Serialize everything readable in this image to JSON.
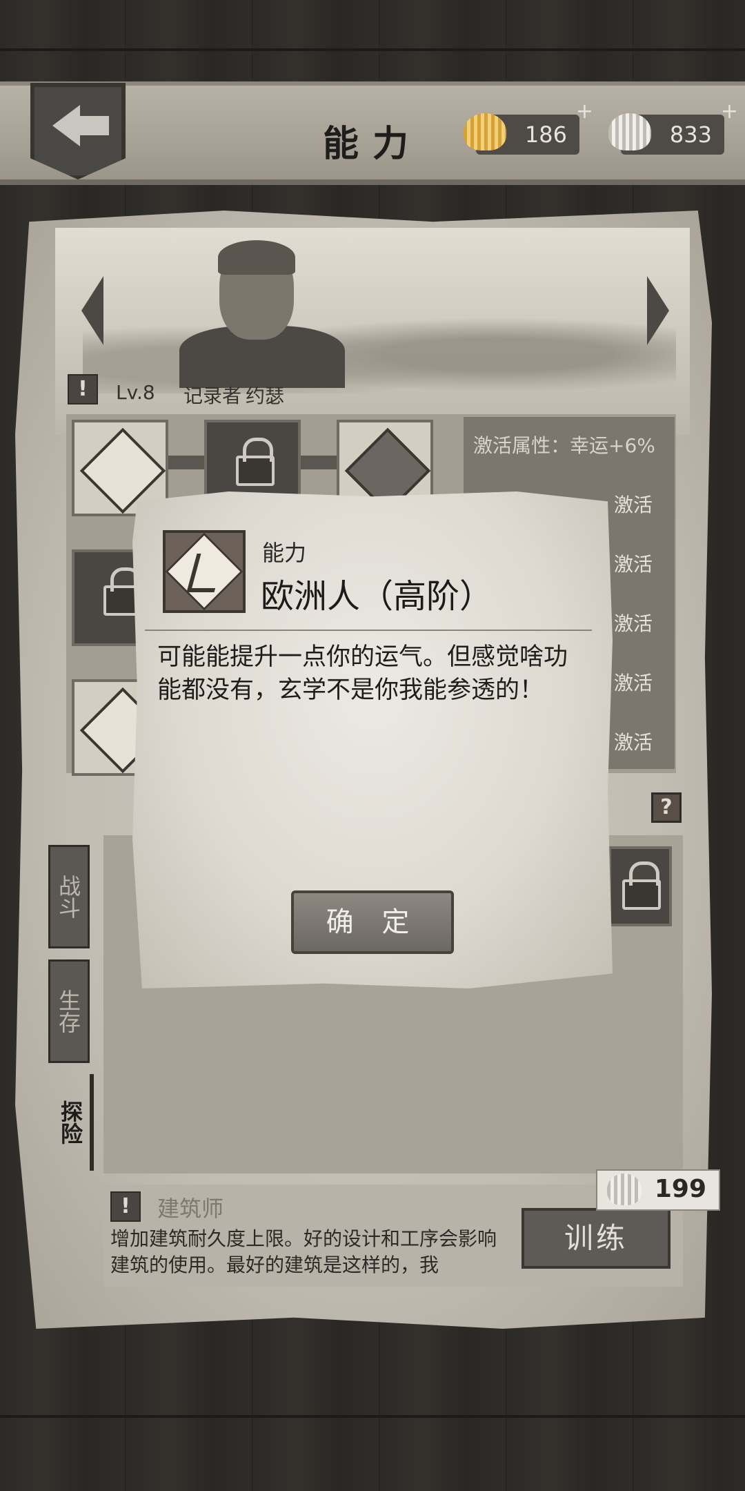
{
  "header": {
    "title": "能力",
    "currency_gold": "186",
    "currency_silver": "833",
    "plus_gold": "+",
    "plus_silver": "+"
  },
  "character": {
    "level": "Lv.8",
    "role": "记录者",
    "name": "约瑟"
  },
  "attributes": {
    "active": "激活属性：幸运+6%",
    "row1": "激活",
    "row2": "激活",
    "row3": "激活",
    "row4": "激活",
    "row5": "激活"
  },
  "tabs": [
    {
      "label": "战斗"
    },
    {
      "label": "生存"
    },
    {
      "label": "探险"
    }
  ],
  "skill_desc": {
    "title": "建筑师",
    "text": "增加建筑耐久度上限。好的设计和工序会影响建筑的使用。最好的建筑是这样的，我"
  },
  "train": {
    "label": "训练",
    "cost": "199"
  },
  "modal": {
    "kind": "能力",
    "name": "欧洲人（高阶）",
    "description": "可能能提升一点你的运气。但感觉啥功能都没有，玄学不是你我能参透的！",
    "confirm": "确 定"
  },
  "icons": [
    "back-arrow-icon",
    "gold-shell-icon",
    "silver-shell-icon",
    "warning-icon",
    "lock-icon",
    "stomach-icon",
    "wolf-icon",
    "gun-crossed-icon",
    "question-icon",
    "rider-icon"
  ],
  "colors": {
    "bg": "#2a2826",
    "parchment": "#c2bdb3",
    "modal": "#e4e0d8",
    "dark": "#4a4743"
  }
}
